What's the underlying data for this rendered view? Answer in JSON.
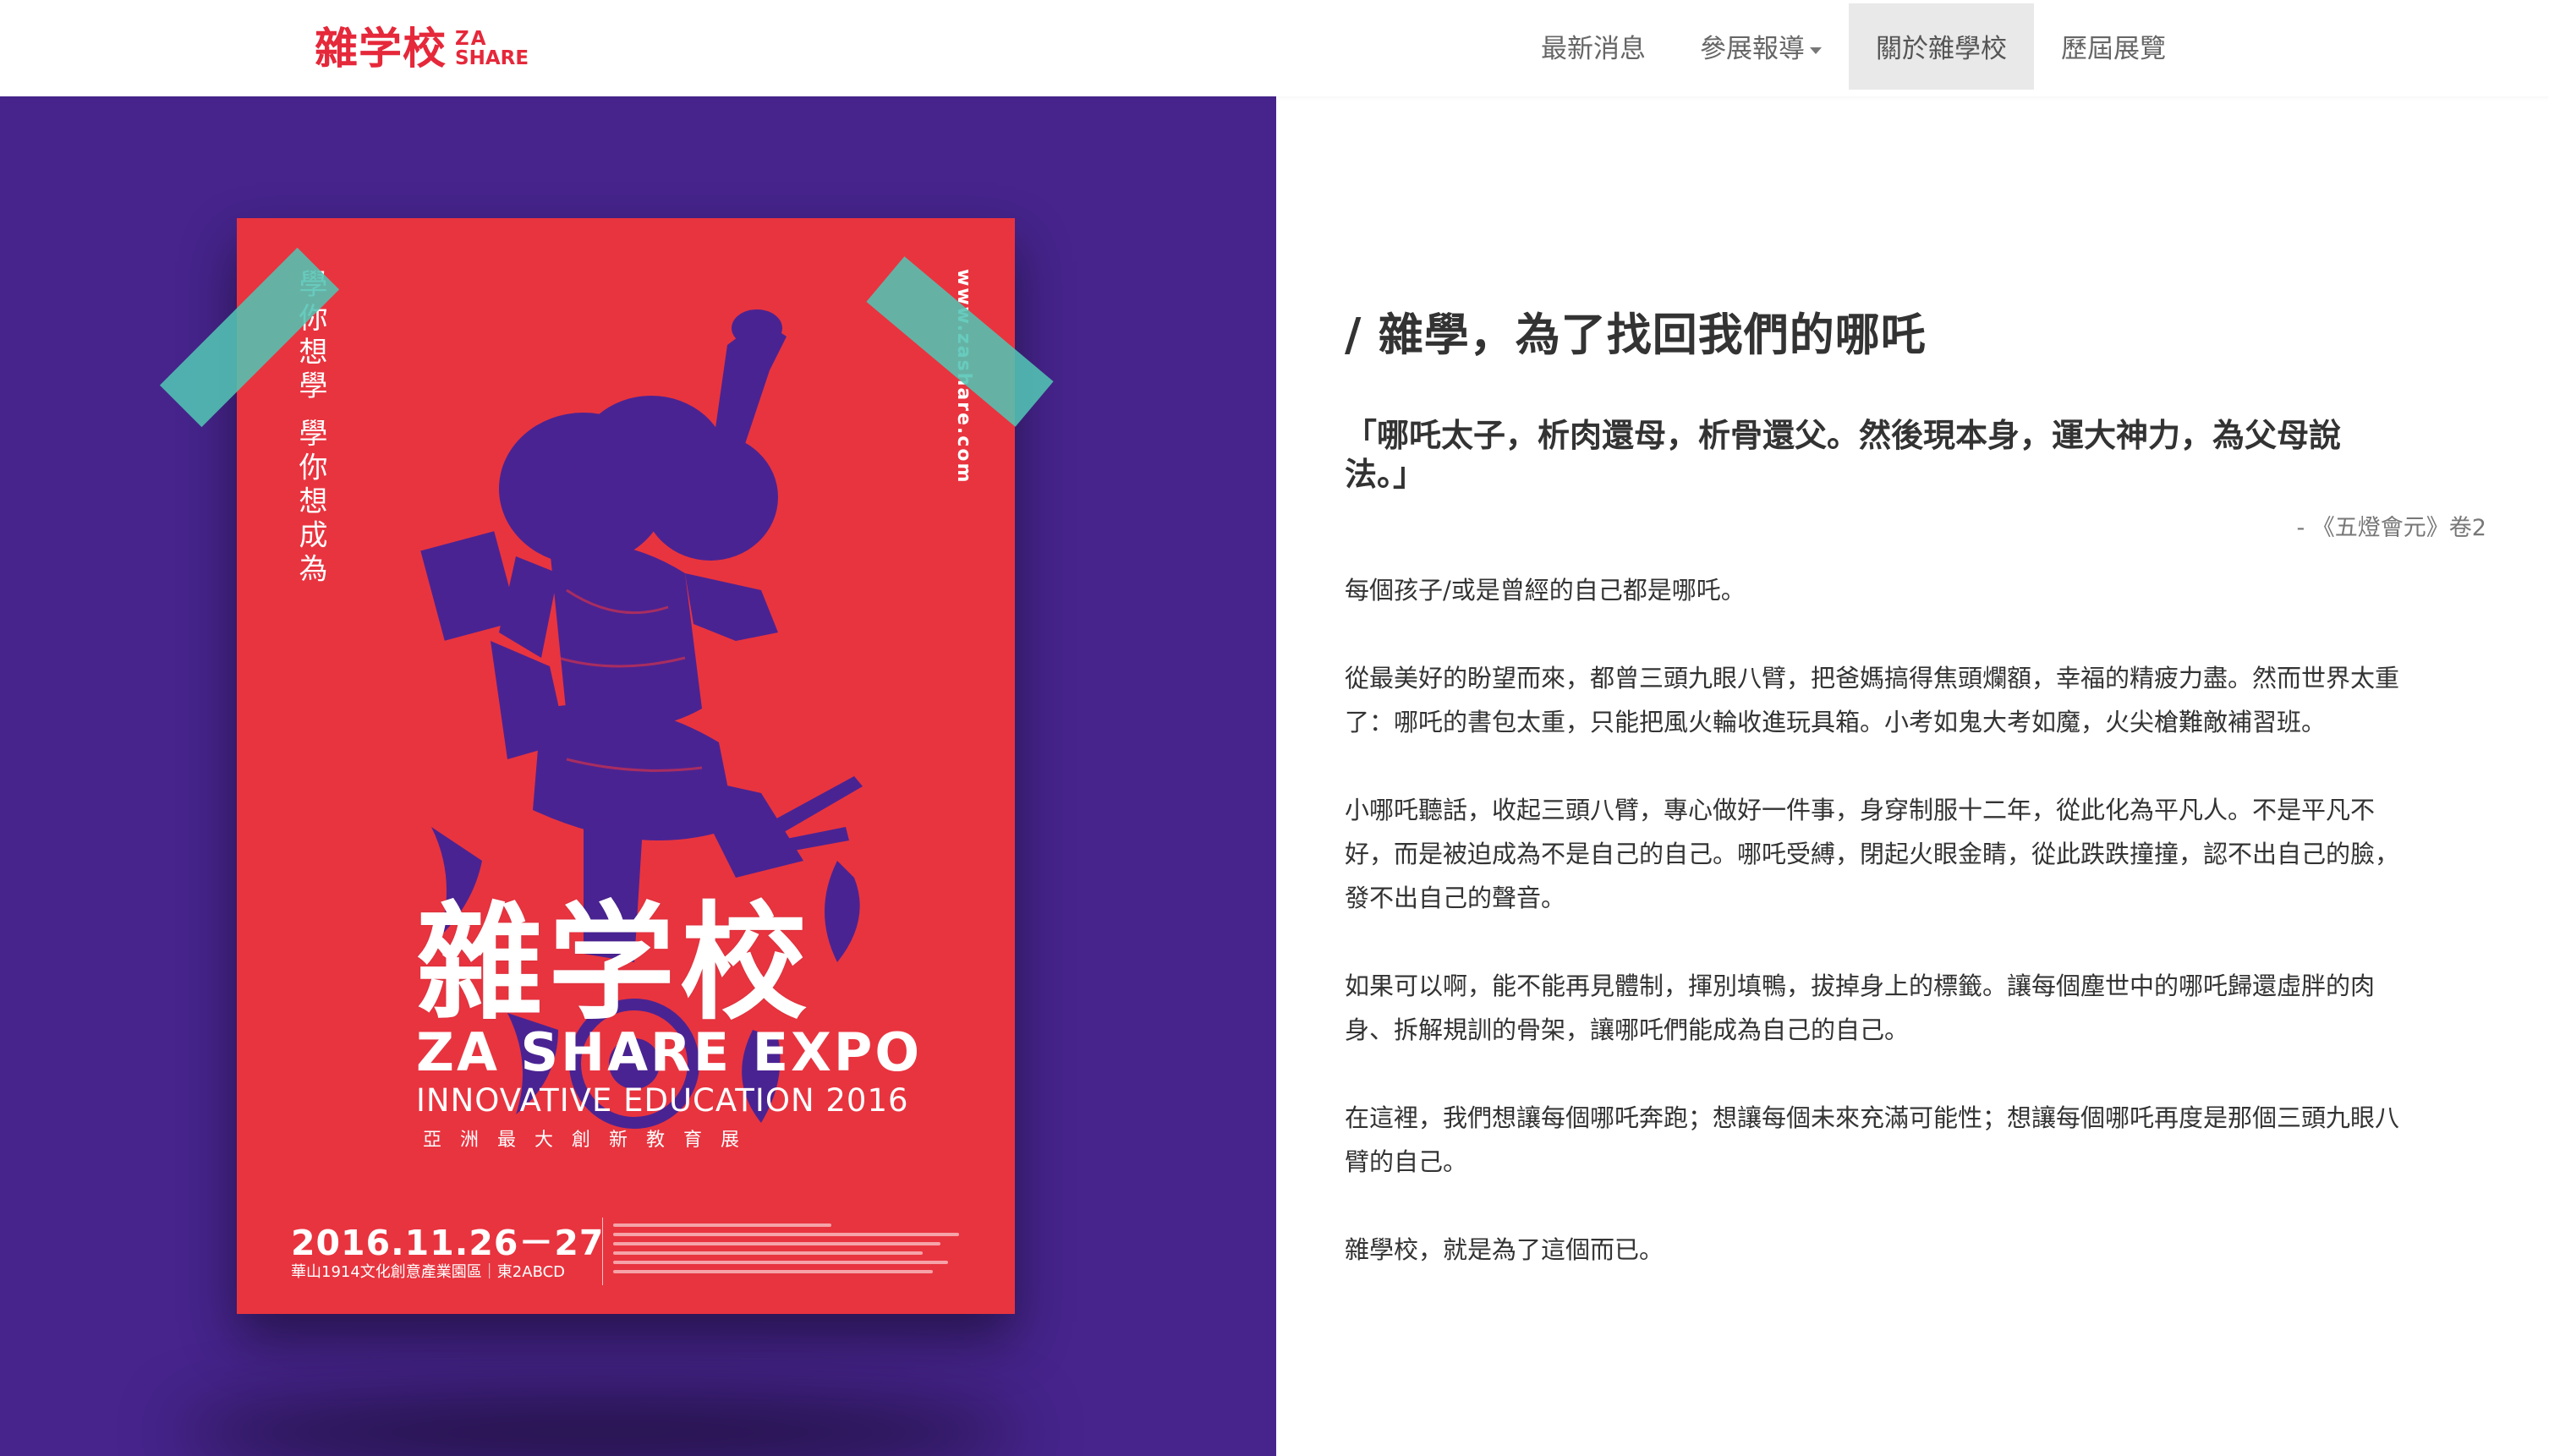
{
  "header": {
    "logo_cn": "雜学校",
    "logo_en_line1": "ZA",
    "logo_en_line2": "SHARE",
    "nav": [
      {
        "label": "最新消息"
      },
      {
        "label": "參展報導"
      },
      {
        "label": "關於雜學校"
      },
      {
        "label": "歷屆展覽"
      }
    ]
  },
  "poster": {
    "slogan": "學你想學 學你想成為",
    "url": "www.zashare.com",
    "title": "雜学校",
    "expo": "ZA SHARE EXPO",
    "edu": "INNOVATIVE EDUCATION 2016",
    "sub": "亞洲最大創新教育展",
    "date": "2016.11.26－27",
    "venue": "華山1914文化創意產業園區｜東2ABCD"
  },
  "article": {
    "title": "/ 雜學，為了找回我們的哪吒",
    "quote_line1": "「哪吒太子，析肉還母，析骨還父。然後現本身，運大神力，為父母說",
    "quote_line2": "法。」",
    "quote_source": "- 《五燈會元》卷2",
    "paragraphs": [
      [
        "每個孩子/或是曾經的自己都是哪吒。"
      ],
      [
        "從最美好的盼望而來，都曾三頭九眼八臂，把爸媽搞得焦頭爛額，幸福的精疲力盡。然而世界太重",
        "了：哪吒的書包太重，只能把風火輪收進玩具箱。小考如鬼大考如魔，火尖槍難敵補習班。"
      ],
      [
        "小哪吒聽話，收起三頭八臂，專心做好一件事，身穿制服十二年，從此化為平凡人。不是平凡不",
        "好，而是被迫成為不是自己的自己。哪吒受縛，閉起火眼金睛，從此跌跌撞撞，認不出自己的臉，",
        "發不出自己的聲音。"
      ],
      [
        "如果可以啊，能不能再見體制，揮別填鴨，拔掉身上的標籤。讓每個塵世中的哪吒歸還虛胖的肉",
        "身、拆解規訓的骨架，讓哪吒們能成為自己的自己。"
      ],
      [
        "在這裡，我們想讓每個哪吒奔跑；想讓每個未來充滿可能性；想讓每個哪吒再度是那個三頭九眼八",
        "臂的自己。"
      ],
      [
        "雜學校，就是為了這個而已。"
      ]
    ]
  },
  "colors": {
    "brand_red": "#e5283a",
    "poster_red": "#e8343f",
    "panel_purple": "#46248c",
    "tape_teal": "#52c4b4"
  }
}
